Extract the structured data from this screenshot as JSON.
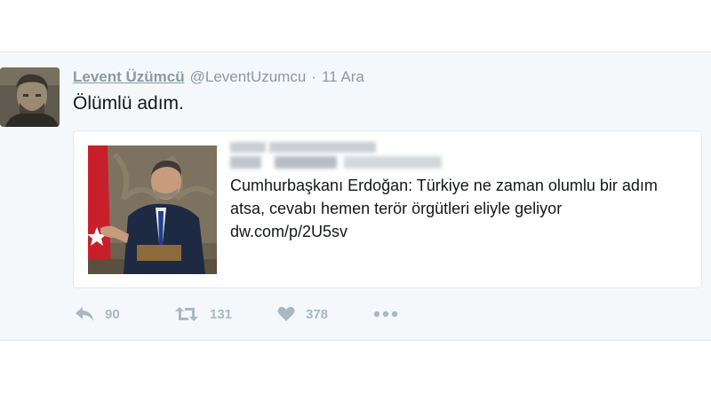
{
  "tweet": {
    "display_name": "Levent Üzümcü",
    "handle": "@LeventUzumcu",
    "separator": "·",
    "time": "11 Ara",
    "text": "Ölümlü adım.",
    "card": {
      "headline": "Cumhurbaşkanı Erdoğan: Türkiye ne zaman olumlu bir adım atsa, cevabı hemen terör örgütleri eliyle geliyor",
      "url": "dw.com/p/2U5sv"
    },
    "actions": {
      "reply_icon": "reply-icon",
      "reply_count": "90",
      "retweet_icon": "retweet-icon",
      "retweet_count": "131",
      "like_icon": "heart-icon",
      "like_count": "378",
      "more_icon": "more-icon"
    }
  },
  "colors": {
    "background": "#ffffff",
    "tweet_background": "#f5f8fa",
    "muted_text": "#8899a6",
    "action_icon": "#aab8c2",
    "text": "#14171a",
    "border": "#e1e8ed"
  }
}
